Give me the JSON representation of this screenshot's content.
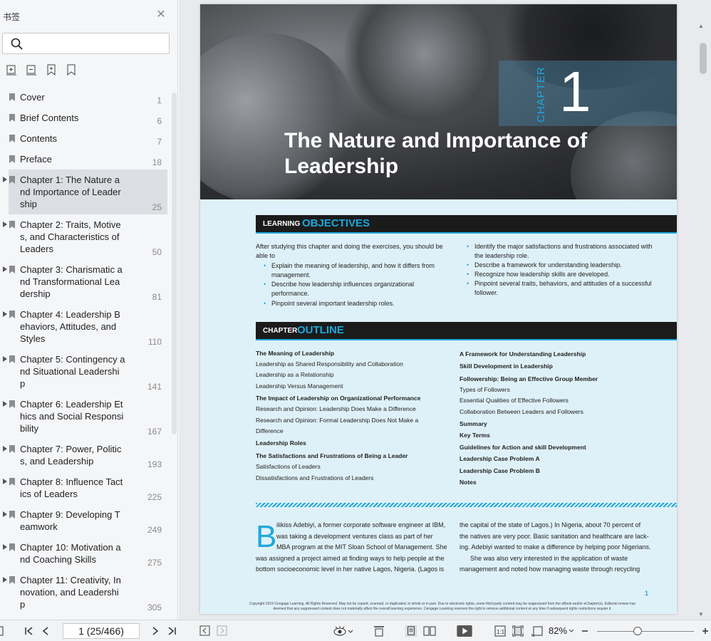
{
  "sidebar": {
    "title": "书签",
    "search": {
      "placeholder": "",
      "value": ""
    },
    "tools": [
      "expand-all-icon",
      "collapse-all-icon",
      "add-bookmark-icon",
      "bookmark-icon"
    ],
    "bookmarks": [
      {
        "label": "Cover",
        "page": "1",
        "expandable": false
      },
      {
        "label": "Brief Contents",
        "page": "6",
        "expandable": false
      },
      {
        "label": "Contents",
        "page": "7",
        "expandable": false
      },
      {
        "label": "Preface",
        "page": "18",
        "expandable": false
      },
      {
        "label": "Chapter 1: The Nature a\nnd Importance of Leader\nship",
        "page": "25",
        "expandable": true,
        "selected": true
      },
      {
        "label": "Chapter 2: Traits, Motive\ns, and Characteristics of\nLeaders",
        "page": "50",
        "expandable": true
      },
      {
        "label": "Chapter 3: Charismatic a\nnd Transformational Lea\ndership",
        "page": "81",
        "expandable": true
      },
      {
        "label": "Chapter 4: Leadership B\nehaviors, Attitudes, and\nStyles",
        "page": "110",
        "expandable": true
      },
      {
        "label": "Chapter 5: Contingency a\nnd Situational Leadershi\np",
        "page": "141",
        "expandable": true
      },
      {
        "label": "Chapter 6: Leadership Et\nhics and Social Responsi\nbility",
        "page": "167",
        "expandable": true
      },
      {
        "label": "Chapter 7: Power, Politic\ns, and Leadership",
        "page": "193",
        "expandable": true
      },
      {
        "label": "Chapter 8: Influence Tact\nics of Leaders",
        "page": "225",
        "expandable": true
      },
      {
        "label": "Chapter 9: Developing T\neamwork",
        "page": "249",
        "expandable": true
      },
      {
        "label": "Chapter 10: Motivation a\nnd Coaching Skills",
        "page": "275",
        "expandable": true
      },
      {
        "label": "Chapter 11: Creativity, In\nnovation, and Leadershi\np",
        "page": "305",
        "expandable": true
      }
    ]
  },
  "document": {
    "chapter_word": "CHAPTER",
    "chapter_number": "1",
    "title": "The Nature and Importance of Leadership",
    "objectives": {
      "label_small": "LEARNING",
      "label_big": "OBJECTIVES",
      "intro": "After studying this chapter and doing the exercises, you should be able to",
      "left_items": [
        "Explain the meaning of leadership, and how it differs from management.",
        "Describe how leadership influences organizational performance.",
        "Pinpoint several important leadership roles."
      ],
      "right_items": [
        "Identify the major satisfactions and frustrations associated with the leadership role.",
        "Describe a framework for understanding leadership.",
        "Recognize how leadership skills are developed.",
        "Pinpoint several traits, behaviors, and attitudes of a successful follower."
      ]
    },
    "outline": {
      "label_small": "CHAPTER",
      "label_big": "OUTLINE",
      "left": [
        {
          "text": "The Meaning of Leadership",
          "h": true
        },
        {
          "text": "Leadership as Shared Responsibility and Collaboration",
          "h": false
        },
        {
          "text": "Leadership as a Relationship",
          "h": false
        },
        {
          "text": "Leadership Versus Management",
          "h": false
        },
        {
          "text": "The Impact of Leadership on Organizational Performance",
          "h": true
        },
        {
          "text": "Research and Opinion: Leadership Does Make a Difference",
          "h": false
        },
        {
          "text": "Research and Opinion: Formal Leadership Does Not Make a",
          "h": false
        },
        {
          "text": "Difference",
          "h": false
        },
        {
          "text": "Leadership Roles",
          "h": true
        },
        {
          "text": "The Satisfactions and Frustrations of Being a Leader",
          "h": true
        },
        {
          "text": "Satisfactions of Leaders",
          "h": false
        },
        {
          "text": "Dissatisfactions and Frustrations of Leaders",
          "h": false
        }
      ],
      "right": [
        {
          "text": "A Framework for Understanding Leadership",
          "h": true
        },
        {
          "text": "Skill Development in Leadership",
          "h": true
        },
        {
          "text": "Followership: Being an Effective Group Member",
          "h": true
        },
        {
          "text": "Types of Followers",
          "h": false
        },
        {
          "text": "Essential Qualities of Effective Followers",
          "h": false
        },
        {
          "text": "Collaboration Between Leaders and Followers",
          "h": false
        },
        {
          "text": "Summary",
          "h": true
        },
        {
          "text": "Key Terms",
          "h": true
        },
        {
          "text": "Guidelines for Action and skill Development",
          "h": true
        },
        {
          "text": "Leadership Case Problem A",
          "h": true
        },
        {
          "text": "Leadership Case Problem B",
          "h": true
        },
        {
          "text": "Notes",
          "h": true
        }
      ]
    },
    "body": {
      "dropcap": "B",
      "left_lines": [
        "ilikiss Adebiyi, a former corporate software engineer at IBM,",
        "was taking a development ventures class as part of her",
        "MBA program at the MIT Sloan School of Management. She",
        "was assigned a project aimed at finding ways to help people at the",
        "bottom socioeconomic level in her native Lagos, Nigeria. (Lagos is"
      ],
      "right_lines": [
        "the capital of the state of Lagos.) In Nigeria, about 70 percent of",
        "the natives are very poor. Basic sanitation and healthcare are lack-",
        "ing. Adebiyi wanted to make a difference by helping poor Nigerians.",
        "      She was also very interested in the application of waste",
        "management and noted how managing waste through recycling"
      ]
    },
    "page_number": "1",
    "copyright": "Copyright 2019 Cengage Learning. All Rights Reserved. May not be copied, scanned, or duplicated, in whole or in part. Due to electronic rights, some third party content may be suppressed from the eBook and/or eChapter(s). Editorial review has deemed that any suppressed content does not materially affect the overall learning experience. Cengage Learning reserves the right to remove additional content at any time if subsequent rights restrictions require it."
  },
  "toolbar": {
    "page_indicator": "1 (25/466)",
    "zoom": "82%",
    "zoom_level": 0.42
  },
  "colors": {
    "accent": "#1ea7dc",
    "page_bg": "#dff1f8",
    "sidebar_bg": "#f5f6f8",
    "selected_bg": "#dcdee3"
  }
}
